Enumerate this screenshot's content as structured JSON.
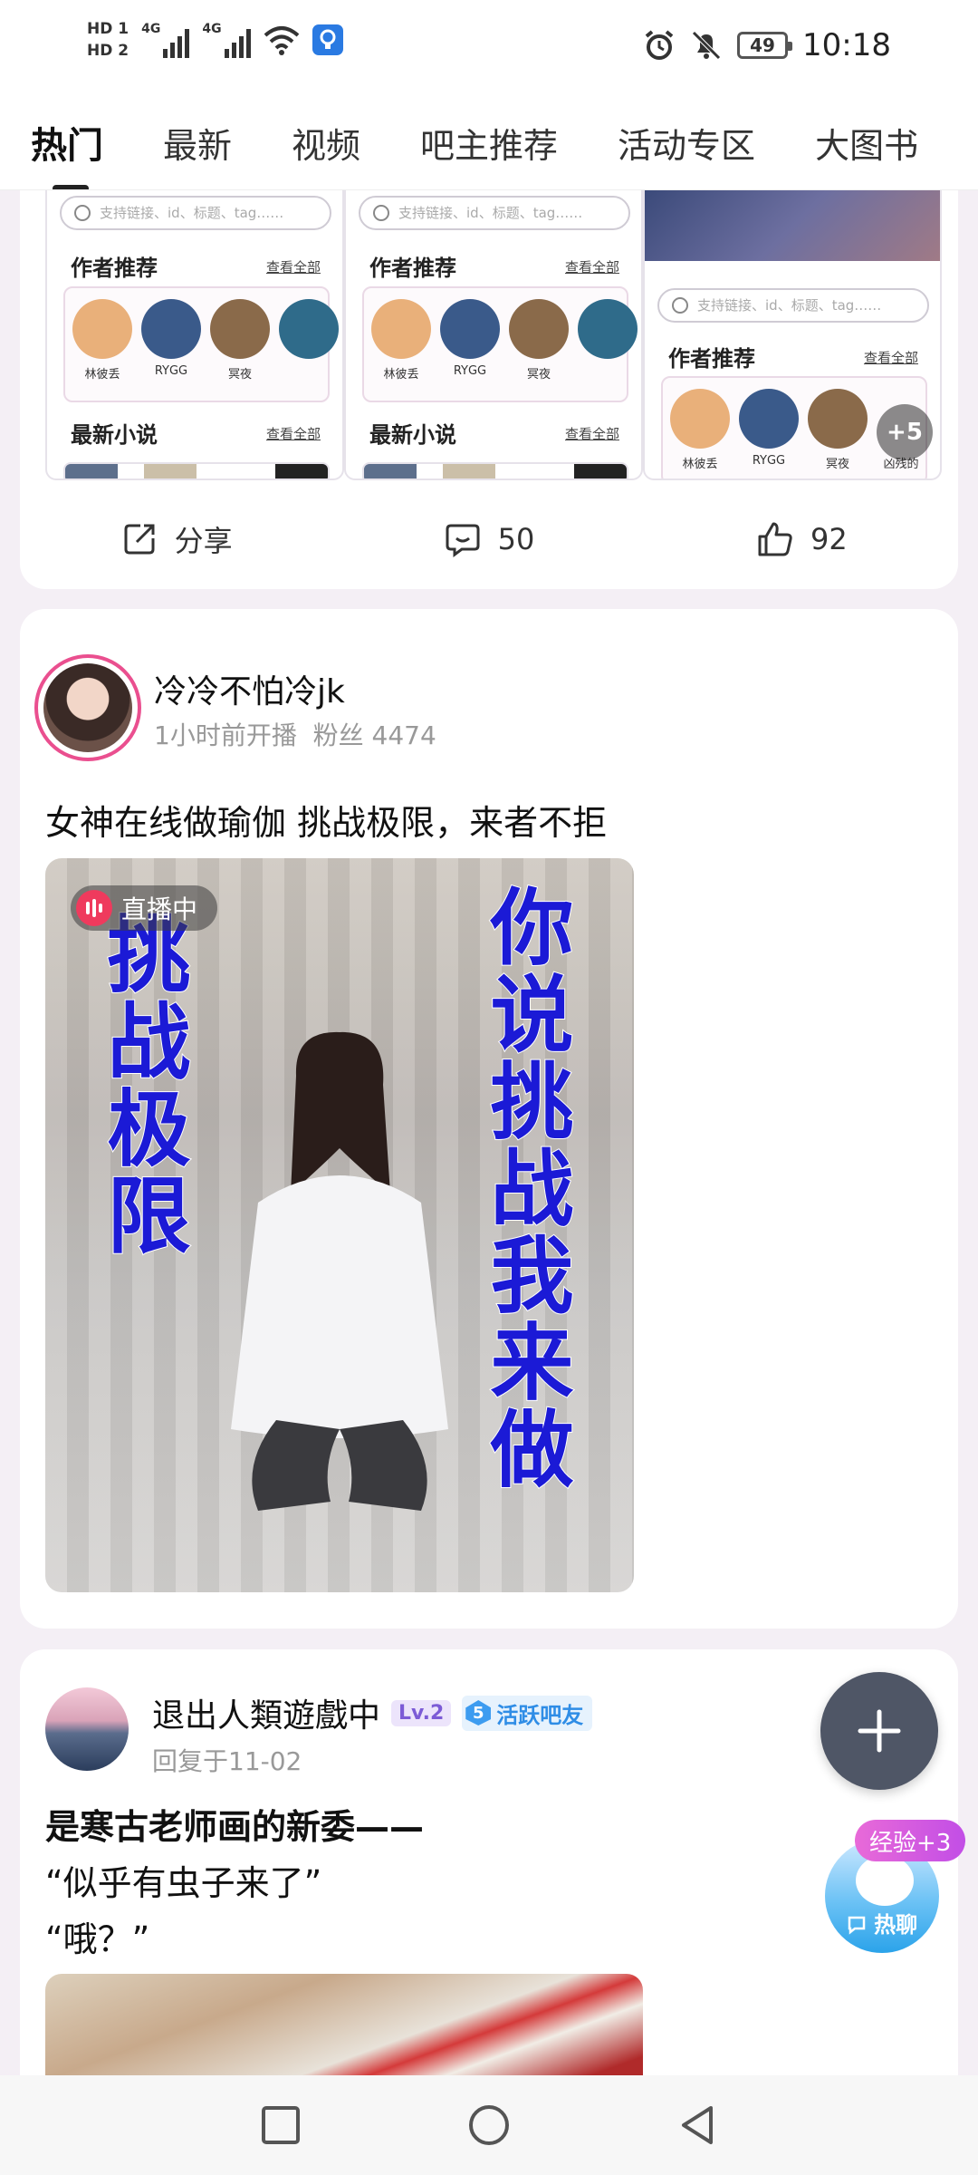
{
  "status_bar": {
    "hd1": "HD 1",
    "hd2": "HD 2",
    "net1": "4G",
    "net2": "4G",
    "battery": "49",
    "time": "10:18"
  },
  "tabs": [
    {
      "label": "热门",
      "active": true
    },
    {
      "label": "最新"
    },
    {
      "label": "视频"
    },
    {
      "label": "吧主推荐"
    },
    {
      "label": "活动专区"
    },
    {
      "label": "大图书"
    }
  ],
  "post1": {
    "thumbs": {
      "search_placeholder": "支持链接、id、标题、tag……",
      "author_heading": "作者推荐",
      "novel_heading": "最新小说",
      "see_all": "查看全部",
      "authors": [
        "林彼丢",
        "RYGG",
        "冥夜",
        "凶残的"
      ],
      "more_count": "+5"
    },
    "actions": {
      "share": "分享",
      "comments": "50",
      "likes": "92"
    }
  },
  "post2": {
    "username": "冷冷不怕冷jk",
    "meta": "1小时前开播  粉丝 4474",
    "text": "女神在线做瑜伽 挑战极限，来者不拒",
    "live_badge": "直播中",
    "overlay_left": "挑战极限",
    "overlay_right": "你说挑战我来做"
  },
  "post3": {
    "username": "退出人類遊戲中",
    "level": "Lv.2",
    "active_num": "5",
    "active_label": "活跃吧友",
    "meta": "回复于11-02",
    "title": "是寒古老师画的新委——",
    "line1": "“似乎有虫子来了”",
    "line2": "“哦？”"
  },
  "floating": {
    "exp_badge": "经验+3",
    "hot_chat": "热聊"
  },
  "colors": {
    "accent_pink": "#ea4f8f",
    "live_red": "#ef3a5d",
    "overlay_blue": "#1b1ad6",
    "fab_gray": "#4f5666"
  }
}
